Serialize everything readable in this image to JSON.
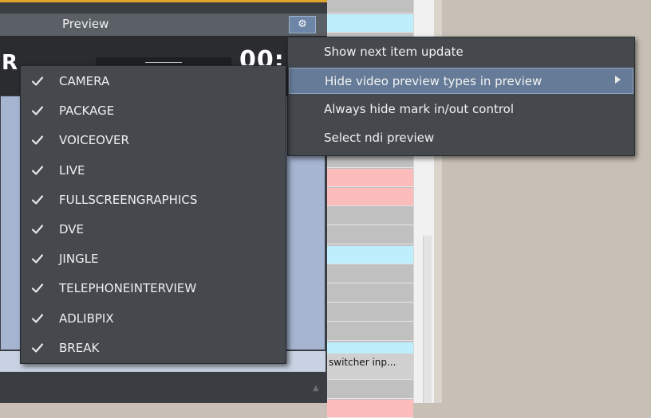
{
  "preview": {
    "title": "Preview",
    "slug_letter": "R",
    "time_fragment": "00:",
    "settings_icon": "gear-icon"
  },
  "rundown": {
    "rows": [
      {
        "color": "#c0c0c0"
      },
      {
        "color": "#bdeefb"
      },
      {
        "color": "#c0c0c0"
      },
      {
        "color": "#c0c0c0"
      },
      {
        "color": "#c0c0c0"
      },
      {
        "color": "#c0c0c0"
      },
      {
        "color": "#c0c0c0"
      },
      {
        "color": "#c0c0c0"
      },
      {
        "color": "#c0c0c0"
      },
      {
        "color": "#fdbcbc"
      },
      {
        "color": "#fdbcbc"
      },
      {
        "color": "#c0c0c0"
      },
      {
        "color": "#c0c0c0"
      },
      {
        "color": "#bdeefb"
      },
      {
        "color": "#c0c0c0"
      },
      {
        "color": "#c0c0c0"
      },
      {
        "color": "#c0c0c0"
      },
      {
        "color": "#c0c0c0"
      },
      {
        "color": "#bdeefb"
      },
      {
        "color": "#d0d0d0"
      },
      {
        "color": "#c0c0c0"
      },
      {
        "color": "#fdbcbc"
      }
    ],
    "visible_cell_text": "switcher inp..."
  },
  "context_menu": {
    "items": [
      {
        "label": "Show next item update",
        "highlighted": false,
        "submenu": false
      },
      {
        "label": "Hide video preview types in preview",
        "highlighted": true,
        "submenu": true
      },
      {
        "label": "Always hide mark in/out control",
        "highlighted": false,
        "submenu": false
      },
      {
        "label": "Select ndi preview",
        "highlighted": false,
        "submenu": false
      }
    ]
  },
  "submenu": {
    "check_icon": "checkmark-icon",
    "items": [
      {
        "label": "CAMERA",
        "checked": true
      },
      {
        "label": "PACKAGE",
        "checked": true
      },
      {
        "label": "VOICEOVER",
        "checked": true
      },
      {
        "label": "LIVE",
        "checked": true
      },
      {
        "label": "FULLSCREENGRAPHICS",
        "checked": true
      },
      {
        "label": "DVE",
        "checked": true
      },
      {
        "label": "JINGLE",
        "checked": true
      },
      {
        "label": "TELEPHONEINTERVIEW",
        "checked": true
      },
      {
        "label": "ADLIBPIX",
        "checked": true
      },
      {
        "label": "BREAK",
        "checked": true
      }
    ]
  },
  "colors": {
    "accent_gold": "#e0a62c",
    "menu_bg": "#45484d",
    "menu_highlight": "#667b98",
    "video_area": "#a6b5d2",
    "rundown_pink": "#fdbcbc",
    "rundown_cyan": "#bdeefb"
  }
}
